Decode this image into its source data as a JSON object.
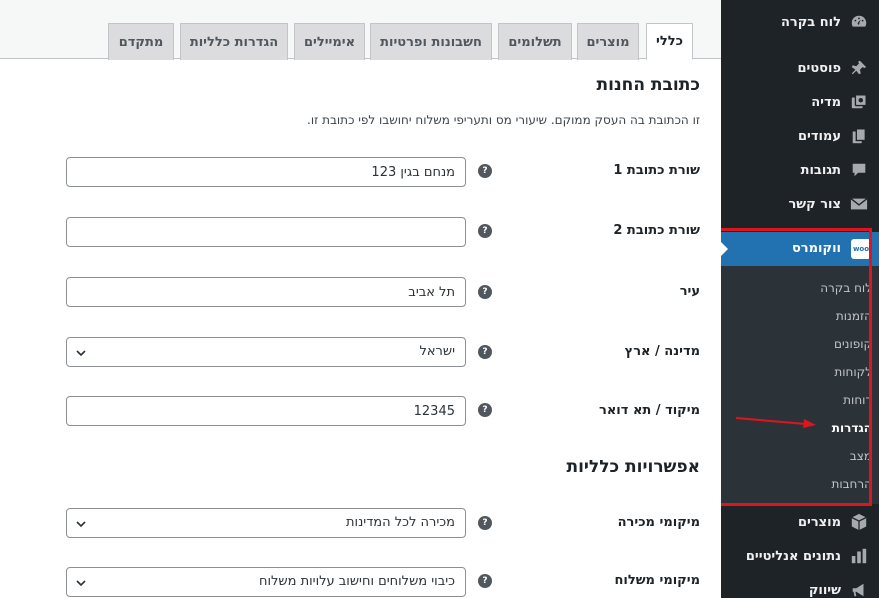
{
  "sidebar": {
    "items": [
      {
        "label": "לוח בקרה",
        "icon": "dashboard-icon"
      },
      {
        "label": "פוסטים",
        "icon": "pin-icon"
      },
      {
        "label": "מדיה",
        "icon": "media-icon"
      },
      {
        "label": "עמודים",
        "icon": "pages-icon"
      },
      {
        "label": "תגובות",
        "icon": "comments-icon"
      },
      {
        "label": "צור קשר",
        "icon": "mail-icon"
      }
    ],
    "woocommerce": {
      "label": "ווקומרס",
      "badge": "woo",
      "icon": "woo-icon"
    },
    "submenu": [
      {
        "label": "לוח בקרה"
      },
      {
        "label": "הזמנות"
      },
      {
        "label": "קופונים"
      },
      {
        "label": "לקוחות"
      },
      {
        "label": "דוחות"
      },
      {
        "label": "הגדרות"
      },
      {
        "label": "מצב"
      },
      {
        "label": "הרחבות"
      }
    ],
    "items_bottom": [
      {
        "label": "מוצרים",
        "icon": "box-icon"
      },
      {
        "label": "נתונים אנליטיים",
        "icon": "bar-chart-icon"
      },
      {
        "label": "שיווק",
        "icon": "megaphone-icon"
      }
    ],
    "highlight_color": "#e0141e"
  },
  "tabs": [
    {
      "label": "כללי"
    },
    {
      "label": "מוצרים"
    },
    {
      "label": "תשלומים"
    },
    {
      "label": "חשבונות ופרטיות"
    },
    {
      "label": "אימיילים"
    },
    {
      "label": "הגדרות כלליות"
    },
    {
      "label": "מתקדם"
    }
  ],
  "store_address": {
    "title": "כתובת החנות",
    "description": "זו הכתובת בה העסק ממוקם. שיעורי מס ותעריפי משלוח יחושבו לפי כתובת זו.",
    "address1": {
      "label": "שורת כתובת 1",
      "value": "מנחם בגין 123"
    },
    "address2": {
      "label": "שורת כתובת 2",
      "value": ""
    },
    "city": {
      "label": "עיר",
      "value": "תל אביב"
    },
    "country": {
      "label": "מדינה / ארץ",
      "value": "ישראל"
    },
    "postcode": {
      "label": "מיקוד / תא דואר",
      "value": "12345"
    }
  },
  "general_options": {
    "title": "אפשרויות כלליות",
    "selling_locations": {
      "label": "מיקומי מכירה",
      "value": "מכירה לכל המדינות"
    },
    "shipping_locations": {
      "label": "מיקומי משלוח",
      "value": "כיבוי משלוחים וחישוב עלויות משלוח"
    }
  },
  "help_glyph": "?"
}
